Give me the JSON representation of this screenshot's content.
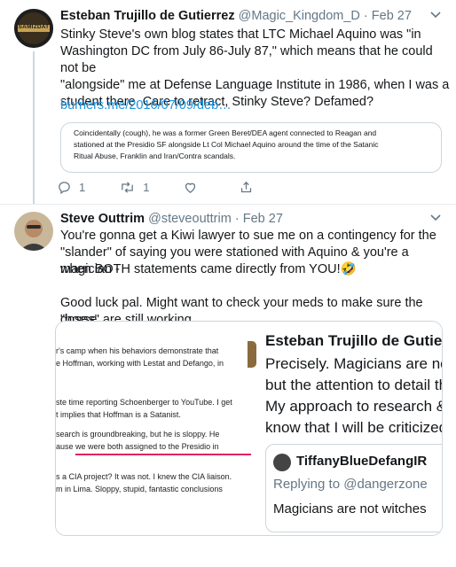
{
  "tweet1": {
    "avatar_label": "SAMIZDAT",
    "name": "Esteban Trujillo de Gutierrez",
    "handle": "@Magic_Kingdom_D",
    "dot": "·",
    "date": "Feb 27",
    "lines": [
      "Stinky Steve's own blog states that LTC Michael Aquino was \"in",
      "Washington DC from July 86-July 87,\" which means that he could not be",
      "\"alongside\" me at Defense Language Institute in 1986, when I was a",
      "student there. Care to retract, Stinky Steve? Defamed?"
    ],
    "link": "burners.me/2016/07/09/deb…",
    "quote_lines": [
      "Coincidentally (cough), he was a former Green Beret/DEA agent connected to Reagan and",
      "stationed at the Presidio SF alongside Lt Col Michael Aquino around the time of the Satanic",
      "Ritual Abuse, Franklin and Iran/Contra scandals."
    ],
    "reply_count": "1",
    "retweet_count": "1",
    "like_count": ""
  },
  "tweet2": {
    "name": "Steve Outtrim",
    "handle": "@steveouttrim",
    "dot": "·",
    "date": "Feb 27",
    "lines": [
      "You're gonna get a Kiwi lawyer to sue me on a contingency for the",
      "\"slander\" of saying you were stationed with Aquino & you're a magician -",
      "when BOTH statements came directly from YOU!🤣",
      "",
      "Good luck pal. Might want to check your meds to make sure the \"horse",
      "doses\" are still working"
    ],
    "media_left_lines": [
      "r's camp when his behaviors demonstrate that",
      "e Hoffman, working with Lestat and Defango, in",
      "",
      "ste time reporting Schoenberger to YouTube. I get",
      "t implies that Hoffman is a Satanist.",
      "",
      "search is groundbreaking, but he is sloppy. He",
      "ause we were both assigned to the Presidio in",
      "",
      "s a CIA project? It was not. I knew the CIA liaison.",
      "m in Lima. Sloppy, stupid, fantastic conclusions"
    ],
    "media_right": {
      "name": "Esteban Trujillo de Gutierr",
      "lines": [
        "Precisely. Magicians are not",
        "but the attention to detail th",
        "My approach to research &",
        "know that I will be criticized"
      ],
      "nested_name": "TiffanyBlueDefangIR",
      "nested_reply": "Replying to @dangerzone",
      "nested_text": "Magicians are not witches"
    }
  },
  "colors": {
    "link": "#1b95e0",
    "muted": "#657786",
    "border": "#ccd6dd",
    "underline": "#e0245e"
  }
}
